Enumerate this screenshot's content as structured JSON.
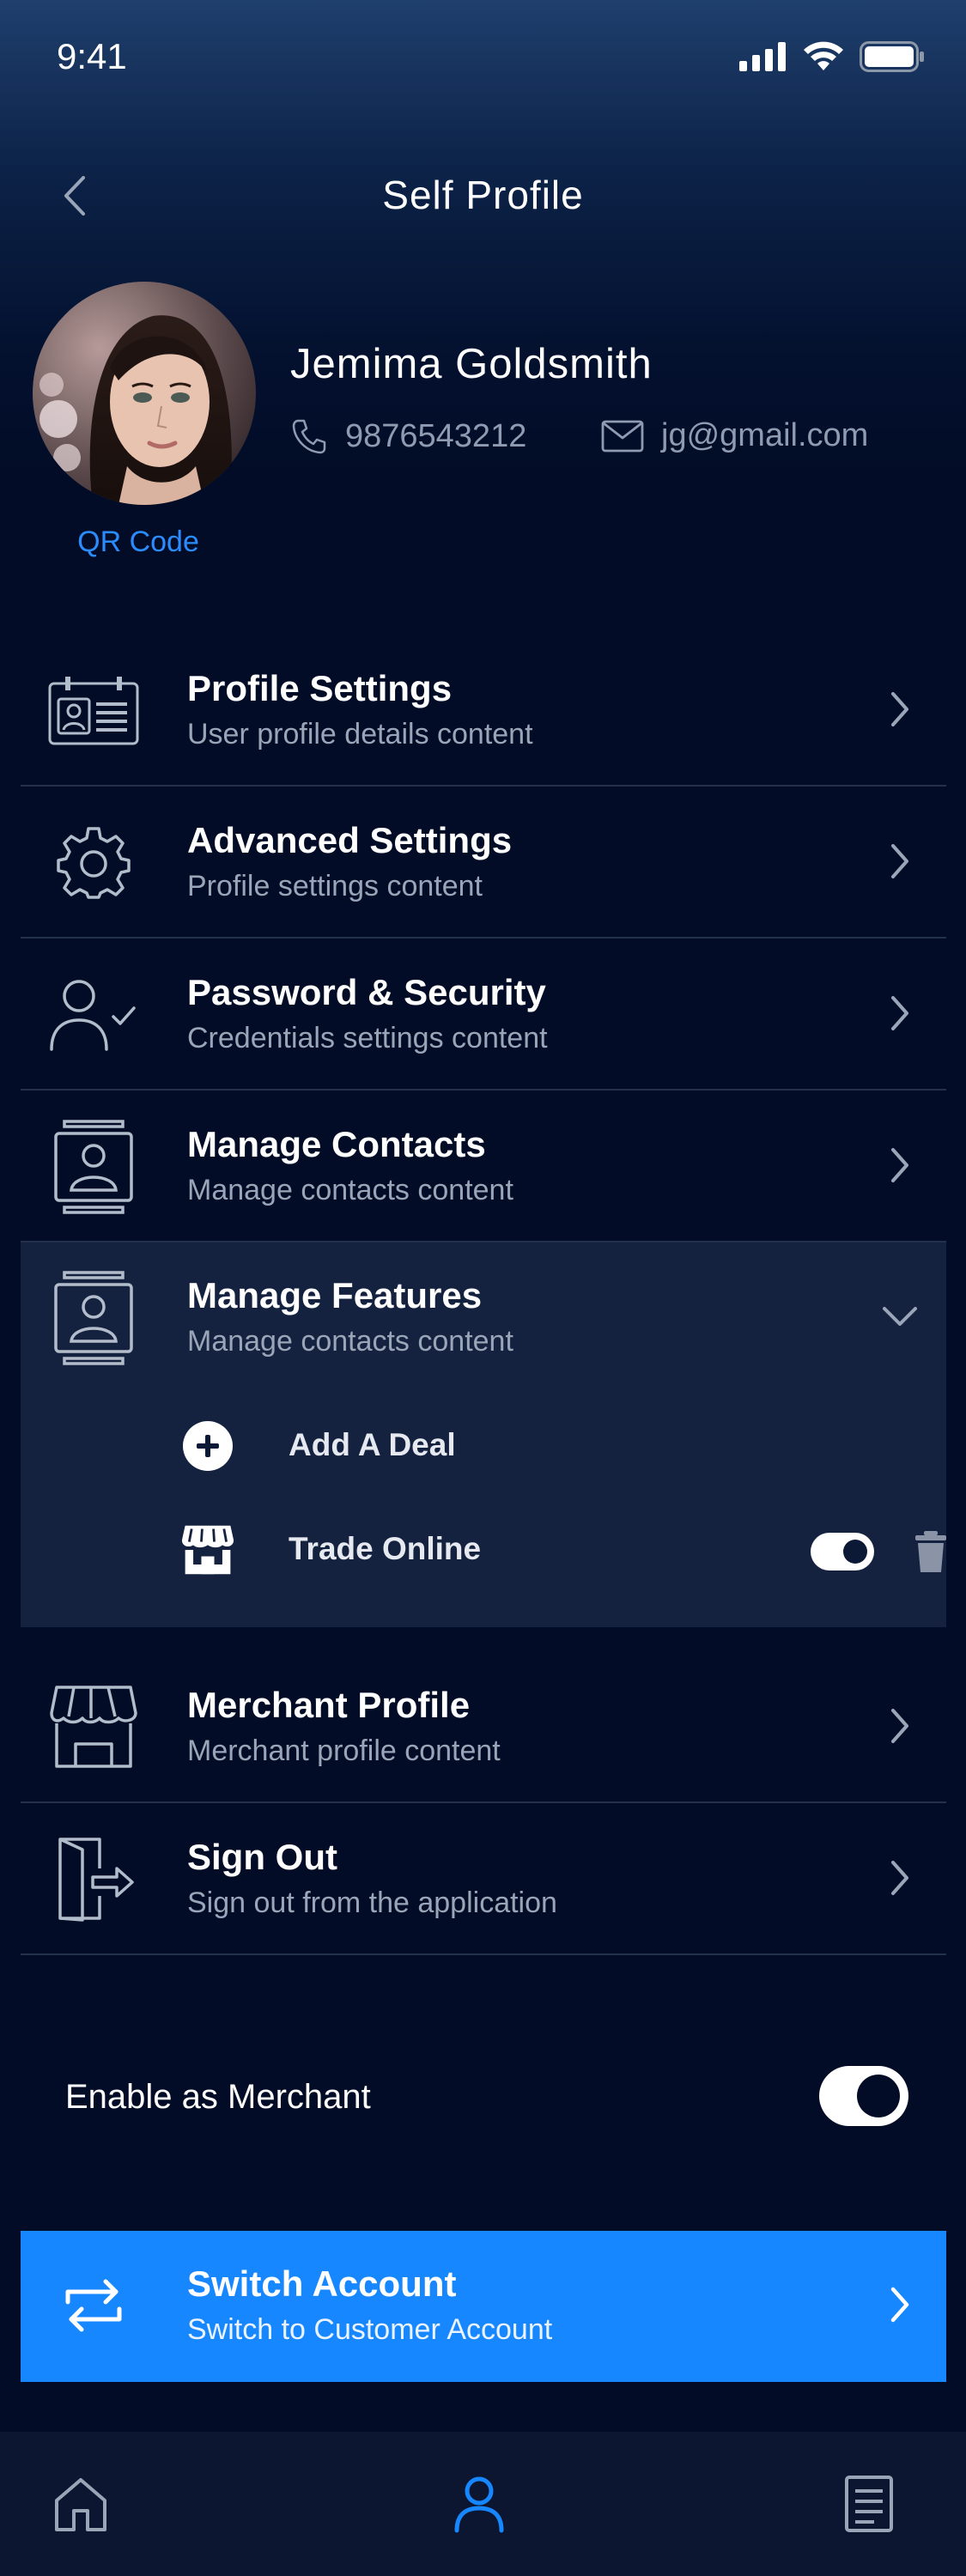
{
  "status_bar": {
    "time": "9:41"
  },
  "header": {
    "title": "Self Profile"
  },
  "profile": {
    "name": "Jemima Goldsmith",
    "phone": "9876543212",
    "email": "jg@gmail.com",
    "qr_label": "QR Code"
  },
  "menu": [
    {
      "title": "Profile Settings",
      "subtitle": "User profile details content",
      "icon": "id-card-icon"
    },
    {
      "title": "Advanced Settings",
      "subtitle": "Profile settings content",
      "icon": "gear-icon"
    },
    {
      "title": "Password & Security",
      "subtitle": "Credentials settings content",
      "icon": "user-check-icon"
    },
    {
      "title": "Manage Contacts",
      "subtitle": "Manage contacts content",
      "icon": "contact-card-icon"
    },
    {
      "title": "Manage Features",
      "subtitle": "Manage contacts content",
      "icon": "contact-card-icon",
      "expanded": true
    },
    {
      "title": "Merchant Profile",
      "subtitle": "Merchant profile content",
      "icon": "storefront-icon"
    },
    {
      "title": "Sign Out",
      "subtitle": "Sign out from the application",
      "icon": "sign-out-icon"
    }
  ],
  "features": {
    "add_deal": "Add A Deal",
    "trade_online": "Trade Online",
    "trade_online_enabled": true
  },
  "merchant": {
    "label": "Enable as Merchant",
    "enabled": true
  },
  "switch_account": {
    "title": "Switch Account",
    "subtitle": "Switch to Customer Account"
  },
  "tabs": [
    {
      "icon": "home-icon",
      "active": false
    },
    {
      "icon": "profile-icon",
      "active": true
    },
    {
      "icon": "document-icon",
      "active": false
    }
  ],
  "colors": {
    "background": "#020c26",
    "accent": "#1687ff",
    "expanded_bg": "#142240",
    "muted_text": "#9aa5b8"
  }
}
